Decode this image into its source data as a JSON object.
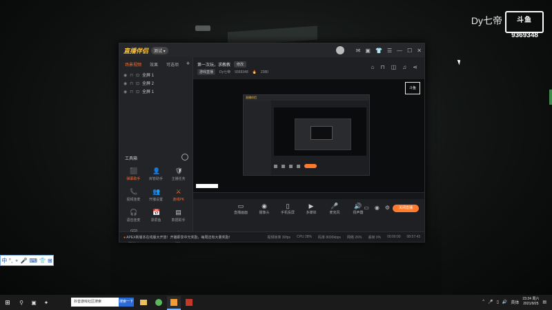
{
  "watermark": {
    "name": "Dy七帝",
    "logo": "斗鱼",
    "room": "9369348"
  },
  "ime": {
    "items": [
      "中",
      "°,",
      "⚬",
      "🎤",
      "⌨",
      "👕",
      "⊞"
    ]
  },
  "app": {
    "title": "直播伴侣",
    "beta": "测试 ▾",
    "sidebar": {
      "tabs": [
        "场景视频",
        "效果",
        "可选项"
      ],
      "scenes": [
        "全屏 1",
        "全屏 2",
        "全屏 1"
      ],
      "tools_header": "工具箱",
      "tools": [
        {
          "label": "弹幕助手",
          "icon": "⬛",
          "highlight": true
        },
        {
          "label": "房管助手",
          "icon": "👤",
          "highlight": false
        },
        {
          "label": "主播任务",
          "icon": "🛡",
          "highlight": false
        },
        {
          "label": "视频连麦",
          "icon": "📞",
          "highlight": false
        },
        {
          "label": "开播设置",
          "icon": "👥",
          "highlight": false
        },
        {
          "label": "连线PK",
          "icon": "⚔",
          "highlight": true
        },
        {
          "label": "语音连麦",
          "icon": "🎧",
          "highlight": false
        },
        {
          "label": "录屏鱼",
          "icon": "📅",
          "highlight": false
        },
        {
          "label": "数据助手",
          "icon": "▤",
          "highlight": false
        },
        {
          "label": "直播间",
          "icon": "🖼",
          "highlight": false
        },
        {
          "label": "",
          "icon": "",
          "highlight": false
        },
        {
          "label": "更多",
          "icon": "◬",
          "highlight": false
        }
      ]
    },
    "room": {
      "title": "第一次玩，求教教",
      "modify": "修改",
      "category": "游戏直播",
      "anchor": "Dy七帝",
      "id": "9369348",
      "hot": "2380"
    },
    "controls": [
      {
        "label": "直播画面",
        "icon": "▭"
      },
      {
        "label": "摄像头",
        "icon": "◉"
      },
      {
        "label": "手机投屏",
        "icon": "▯"
      },
      {
        "label": "多媒体",
        "icon": "▶"
      },
      {
        "label": "麦克风",
        "icon": "🎤"
      },
      {
        "label": "扬声器",
        "icon": "🔊"
      }
    ],
    "live_button": "关闭直播",
    "status": {
      "news": "APEX新版本在线版大开放！开播即享中光奖励，每周还有大量奖励！",
      "stats": [
        "视频帧率 30fps",
        "CPU 28%",
        "码率 8000kbps",
        "网络 26%",
        "丢帧 0%",
        "00:00:00",
        "08:57:43"
      ]
    }
  },
  "taskbar": {
    "search_placeholder": "抖音游戏社区搜索",
    "search_button": "搜索一下",
    "tray_lang": "英体",
    "time": "23:24",
    "day": "周六",
    "date": "2021/9/25"
  }
}
